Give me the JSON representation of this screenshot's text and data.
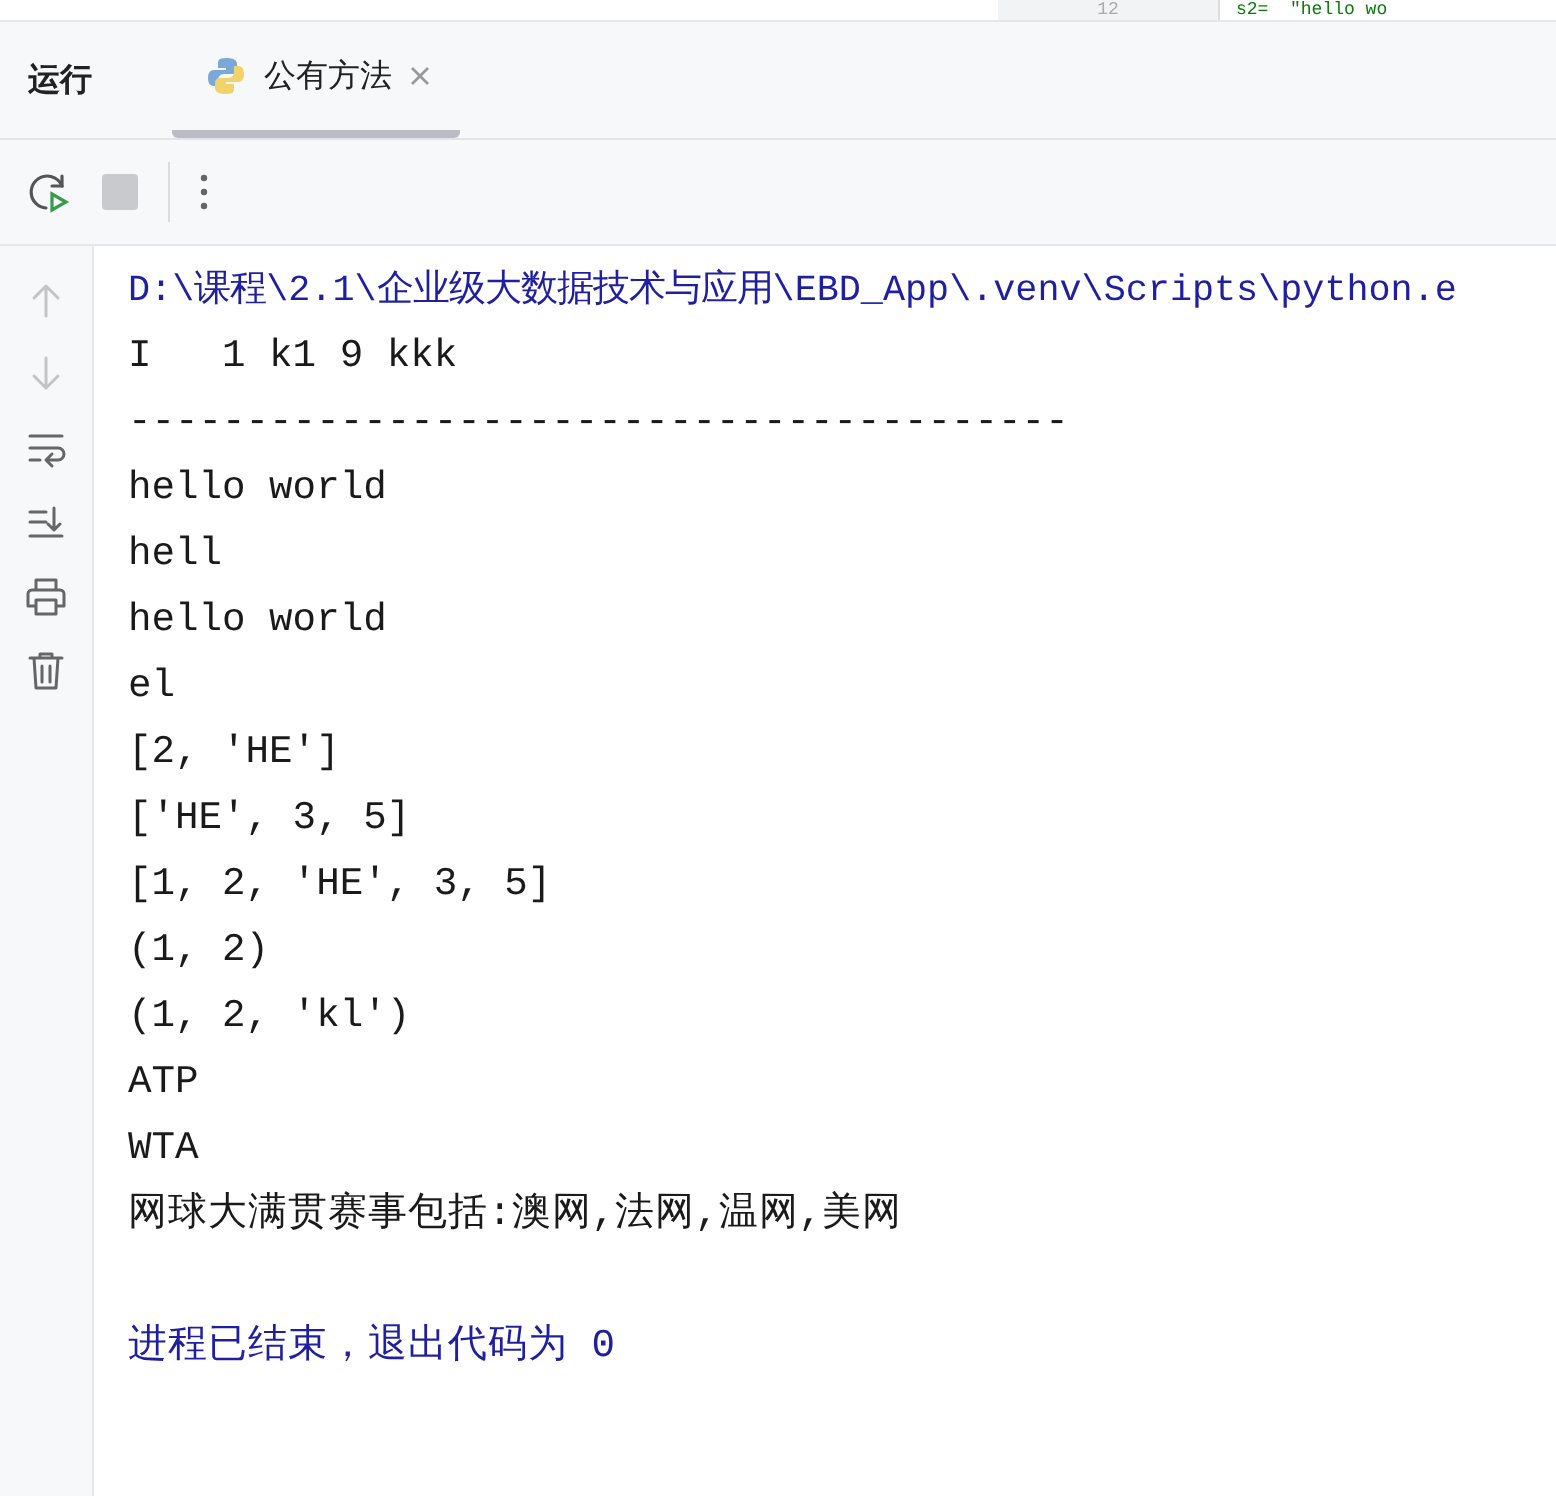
{
  "editor_peek": {
    "line_number": "12",
    "code": "s2=  \"hello wo"
  },
  "run_panel": {
    "title": "运行",
    "tabs": [
      {
        "label": "公有方法",
        "selected": true
      }
    ]
  },
  "console": {
    "lines": [
      {
        "kind": "command",
        "text": "D:\\课程\\2.1\\企业级大数据技术与应用\\EBD_App\\.venv\\Scripts\\python.e"
      },
      {
        "kind": "output",
        "text": "I   1 k1 9 kkk"
      },
      {
        "kind": "output",
        "text": "----------------------------------------"
      },
      {
        "kind": "output",
        "text": "hello world"
      },
      {
        "kind": "output",
        "text": "hell"
      },
      {
        "kind": "output",
        "text": "hello world"
      },
      {
        "kind": "output",
        "text": "el"
      },
      {
        "kind": "output",
        "text": "[2, 'HE']"
      },
      {
        "kind": "output",
        "text": "['HE', 3, 5]"
      },
      {
        "kind": "output",
        "text": "[1, 2, 'HE', 3, 5]"
      },
      {
        "kind": "output",
        "text": "(1, 2)"
      },
      {
        "kind": "output",
        "text": "(1, 2, 'kl')"
      },
      {
        "kind": "output",
        "text": "ATP"
      },
      {
        "kind": "output",
        "text": "WTA"
      },
      {
        "kind": "output",
        "text": "网球大满贯赛事包括:澳网,法网,温网,美网"
      },
      {
        "kind": "blank"
      },
      {
        "kind": "exit",
        "text": "进程已结束，退出代码为 0"
      }
    ]
  }
}
